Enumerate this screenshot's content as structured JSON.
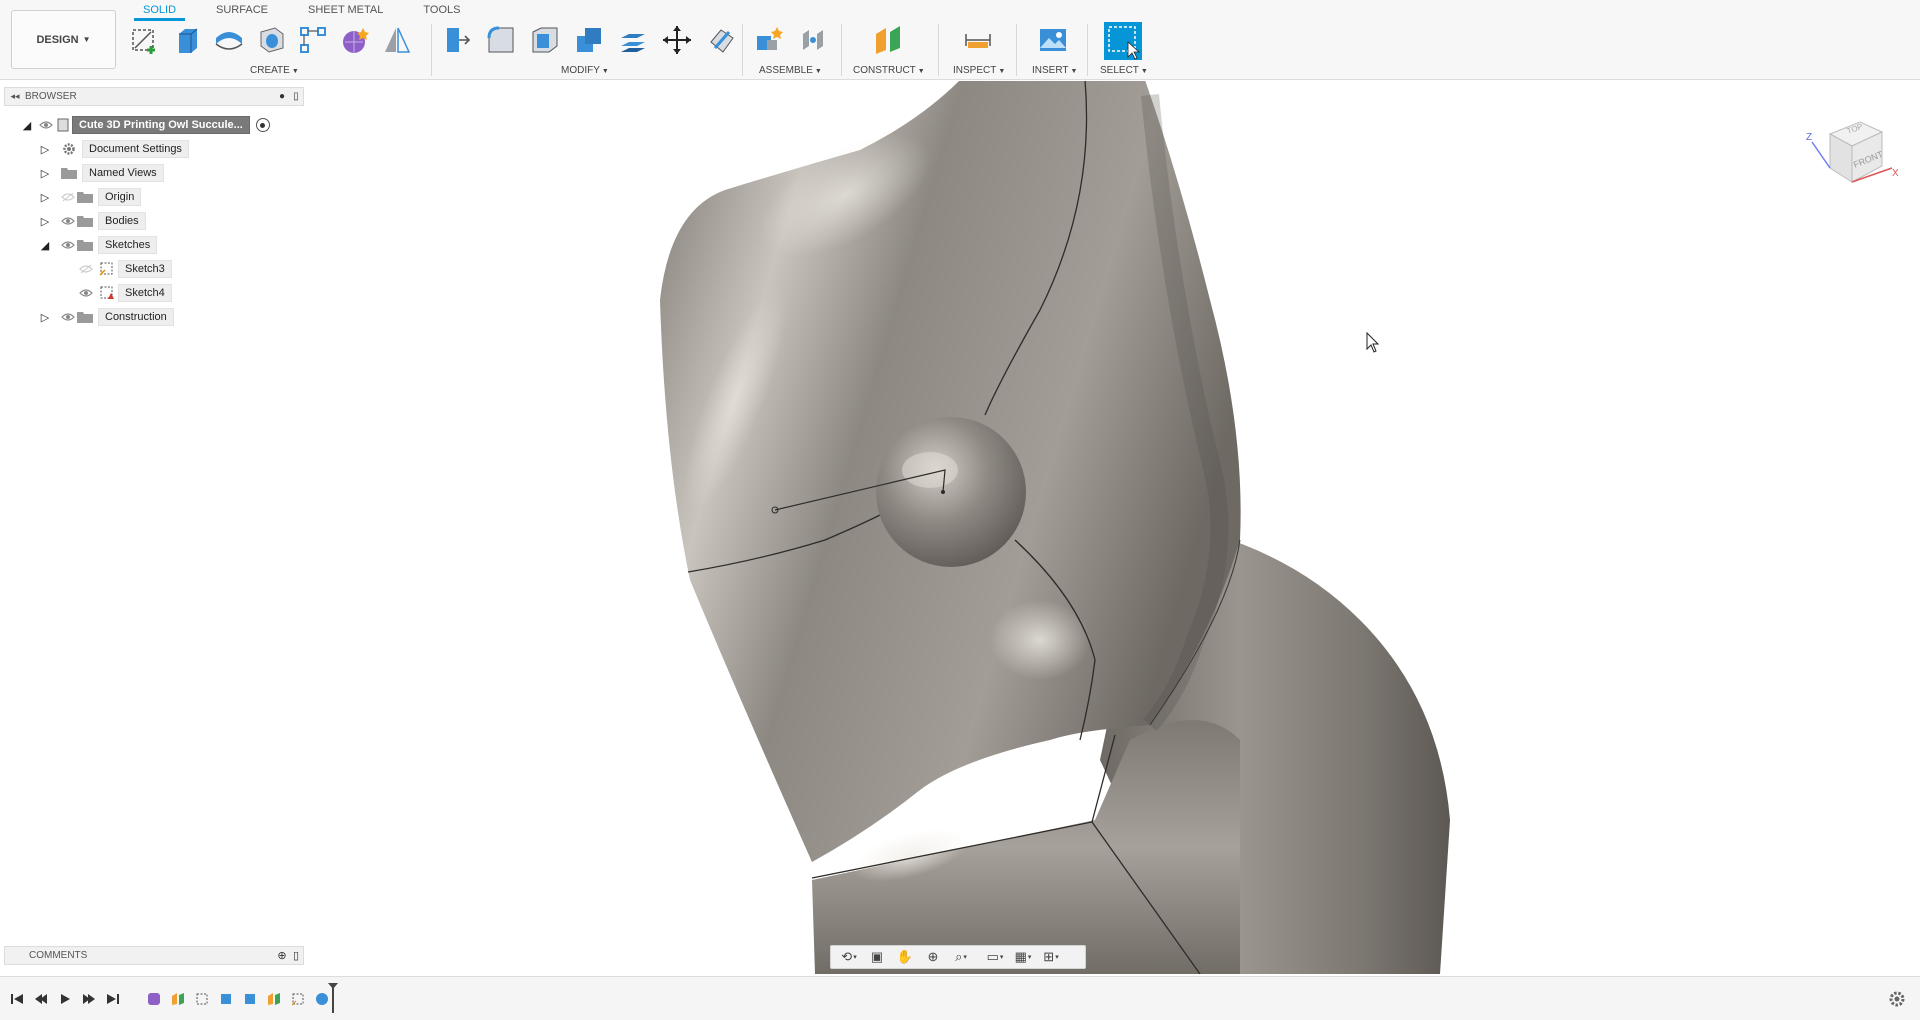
{
  "toolbar": {
    "workspace_button": "DESIGN",
    "tabs": [
      {
        "label": "SOLID",
        "active": true
      },
      {
        "label": "SURFACE",
        "active": false
      },
      {
        "label": "SHEET METAL",
        "active": false
      },
      {
        "label": "TOOLS",
        "active": false
      }
    ],
    "groups": {
      "create": "CREATE",
      "modify": "MODIFY",
      "assemble": "ASSEMBLE",
      "construct": "CONSTRUCT",
      "inspect": "INSPECT",
      "insert": "INSERT",
      "select": "SELECT"
    },
    "create_tools": [
      "create-sketch-icon",
      "extrude-icon",
      "revolve-icon",
      "hole-icon",
      "rectangular-pattern-icon",
      "form-icon",
      "mirror-icon"
    ],
    "modify_tools": [
      "press-pull-icon",
      "fillet-icon",
      "shell-icon",
      "combine-icon",
      "offset-face-icon",
      "move-icon",
      "split-body-icon"
    ],
    "assemble_tools": [
      "new-component-icon",
      "joint-icon"
    ],
    "construct_tools": [
      "offset-plane-icon"
    ],
    "inspect_tools": [
      "measure-icon"
    ],
    "insert_tools": [
      "insert-image-icon"
    ],
    "select_tools": [
      "select-box-icon"
    ]
  },
  "browser": {
    "title": "BROWSER",
    "root": "Cute 3D Printing Owl Succule...",
    "items": [
      {
        "label": "Document Settings",
        "icon": "gear-icon"
      },
      {
        "label": "Named Views",
        "icon": "folder-icon"
      },
      {
        "label": "Origin",
        "icon": "folder-icon"
      },
      {
        "label": "Bodies",
        "icon": "folder-icon"
      },
      {
        "label": "Sketches",
        "icon": "folder-icon"
      },
      {
        "label": "Sketch3",
        "icon": "sketch-icon"
      },
      {
        "label": "Sketch4",
        "icon": "sketch-error-icon"
      },
      {
        "label": "Construction",
        "icon": "folder-icon"
      }
    ]
  },
  "comments": {
    "title": "COMMENTS"
  },
  "viewcube": {
    "top": "TOP",
    "front": "FRONT",
    "axis_x": "X",
    "axis_z": "Z"
  },
  "nav_bar": [
    "orbit-icon",
    "look-at-icon",
    "pan-icon",
    "zoom-icon",
    "zoom-window-icon",
    "display-settings-icon",
    "grid-icon",
    "viewports-icon"
  ],
  "timeline": {
    "controls": [
      "first-icon",
      "previous-icon",
      "play-icon",
      "next-icon",
      "last-icon"
    ],
    "features": [
      "form-feature",
      "construct-feature",
      "sketch-feature",
      "extrude-feature",
      "body-feature",
      "construct-feature-2",
      "sketch-feature-2",
      "sphere-feature"
    ]
  },
  "colors": {
    "accent": "#0696d7",
    "model": "#8a8580",
    "toolbar_bg": "#f7f7f7"
  }
}
